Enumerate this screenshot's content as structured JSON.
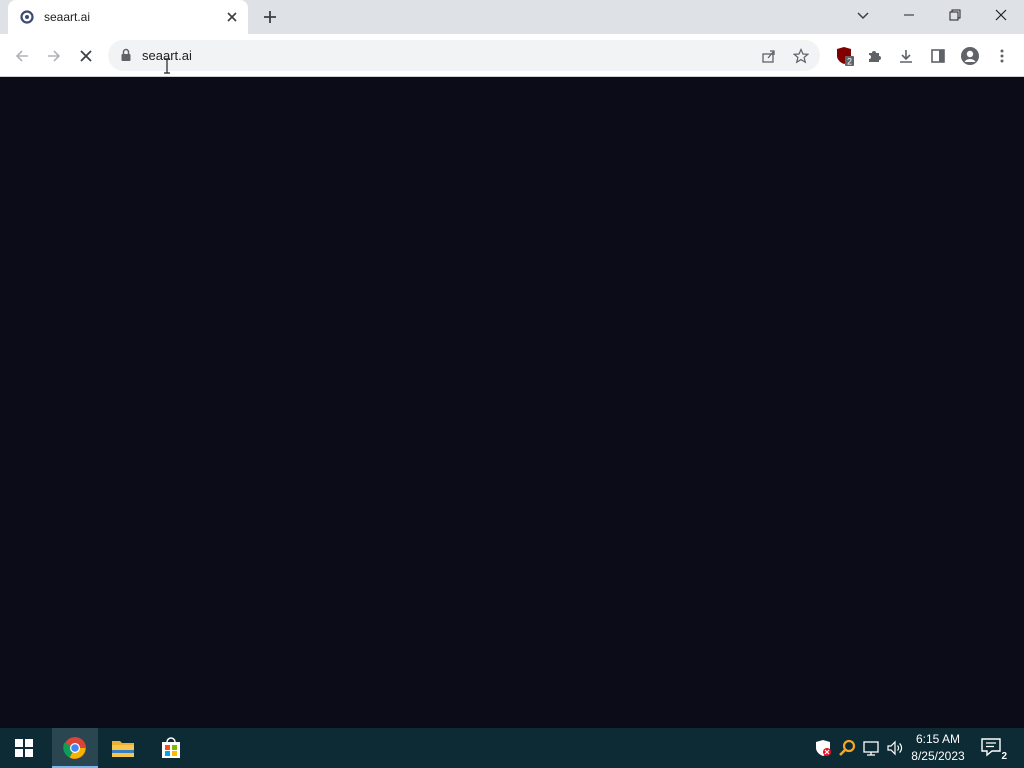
{
  "browser": {
    "tab": {
      "title": "seaart.ai",
      "favicon": "seaart-favicon"
    },
    "omnibox": {
      "url": "seaart.ai"
    },
    "extensions": {
      "ublock_badge": "2"
    }
  },
  "taskbar": {
    "clock_time": "6:15 AM",
    "clock_date": "8/25/2023",
    "notification_count": "2"
  },
  "colors": {
    "page_background": "#0b0c17",
    "tabstrip": "#dee1e6",
    "taskbar": "#0d2b35"
  }
}
